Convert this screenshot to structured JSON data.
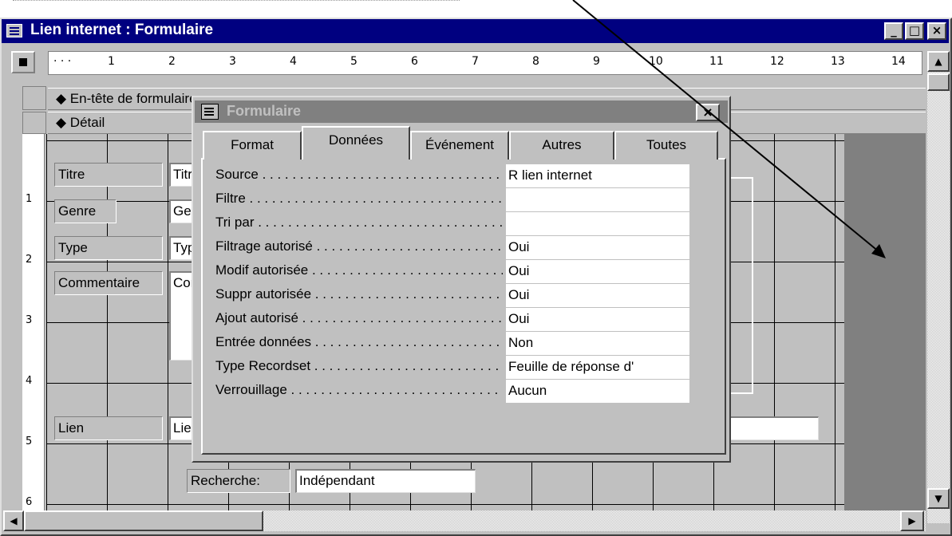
{
  "window": {
    "title": "Lien internet : Formulaire",
    "minimize_label": "_",
    "maximize_label": "□",
    "close_label": "×"
  },
  "ruler": {
    "h_labels": [
      "1",
      "2",
      "3",
      "4",
      "5",
      "6",
      "7",
      "8",
      "9",
      "10",
      "11",
      "12",
      "13",
      "14"
    ],
    "v_labels": [
      "1",
      "2",
      "3",
      "4",
      "5",
      "6"
    ]
  },
  "sections": {
    "header": "◆ En-tête de formulaire",
    "detail": "◆ Détail"
  },
  "form": {
    "labels": {
      "titre": "Titre",
      "genre": "Genre",
      "type": "Type",
      "commentaire": "Commentaire",
      "lien": "Lien",
      "recherche": "Recherche:"
    },
    "fields": {
      "titre": "Titre",
      "genre": "Genre",
      "type": "Type",
      "commentaire": "Commentaire",
      "lien": "Lien",
      "recherche": "Indépendant"
    }
  },
  "dialog": {
    "title": "Formulaire",
    "close_label": "×",
    "tabs": [
      "Format",
      "Données",
      "Événement",
      "Autres",
      "Toutes"
    ],
    "active_tab": "Données",
    "properties": [
      {
        "name": "Source",
        "value": "R lien internet"
      },
      {
        "name": "Filtre",
        "value": ""
      },
      {
        "name": "Tri par",
        "value": ""
      },
      {
        "name": "Filtrage autorisé",
        "value": "Oui"
      },
      {
        "name": "Modif autorisée",
        "value": "Oui"
      },
      {
        "name": "Suppr autorisée",
        "value": "Oui"
      },
      {
        "name": "Ajout autorisé",
        "value": "Oui"
      },
      {
        "name": "Entrée données",
        "value": "Non"
      },
      {
        "name": "Type Recordset",
        "value": "Feuille de réponse d'"
      },
      {
        "name": "Verrouillage",
        "value": "Aucun"
      }
    ]
  },
  "scrollbars": {
    "up": "▲",
    "down": "▼",
    "left": "◀",
    "right": "▶"
  }
}
